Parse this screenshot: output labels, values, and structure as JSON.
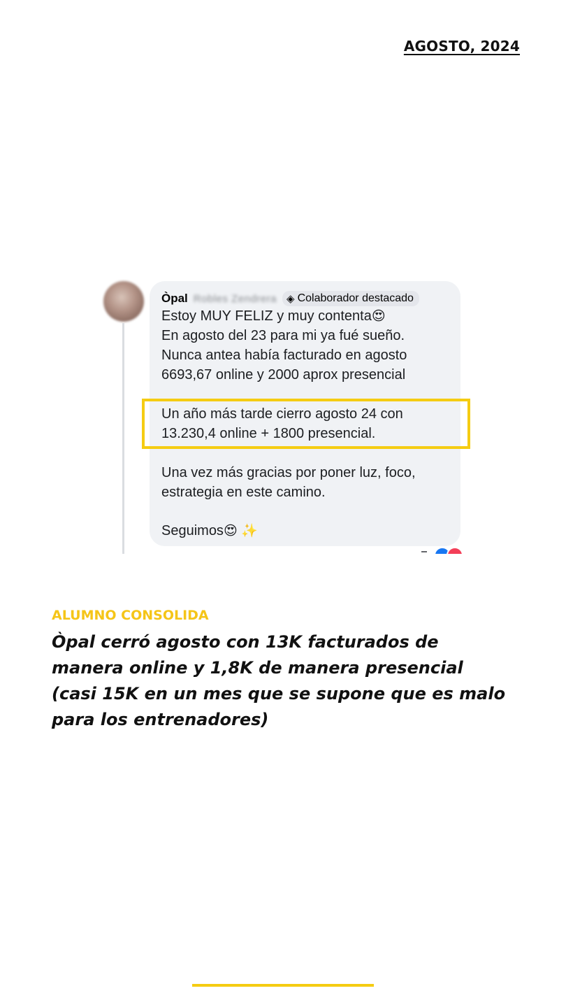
{
  "header": {
    "date": "AGOSTO, 2024"
  },
  "post": {
    "author_first": "Òpal",
    "author_rest_blurred": "Robles Zendrera",
    "badge_icon": "diamond-badge-icon",
    "badge_label": "Colaborador destacado",
    "lines": [
      "Estoy MUY FELIZ y muy contenta",
      "En agosto del 23 para mi ya fué sueño.",
      "Nunca antea había facturado en agosto",
      "6693,67 online y 2000 aprox presencial"
    ],
    "emoji_smile_hearts": "😍",
    "highlight_lines": [
      "Un año más tarde cierro agosto 24 con",
      "13.230,4 online + 1800 presencial."
    ],
    "closing_lines": [
      "Una vez más gracias por poner luz, foco,",
      "estrategia en este camino."
    ],
    "signoff": "Seguimos",
    "sparkles": "✨",
    "highlight_color": "#f5cc12"
  },
  "section": {
    "kicker": "ALUMNO CONSOLIDA",
    "kicker_color": "#f5c518",
    "headline_lines": [
      "Òpal cerró agosto con 13K facturados de",
      "manera online y 1,8K de manera presencial",
      "(casi 15K en un mes que se supone que es malo",
      "para los entrenadores)"
    ]
  }
}
